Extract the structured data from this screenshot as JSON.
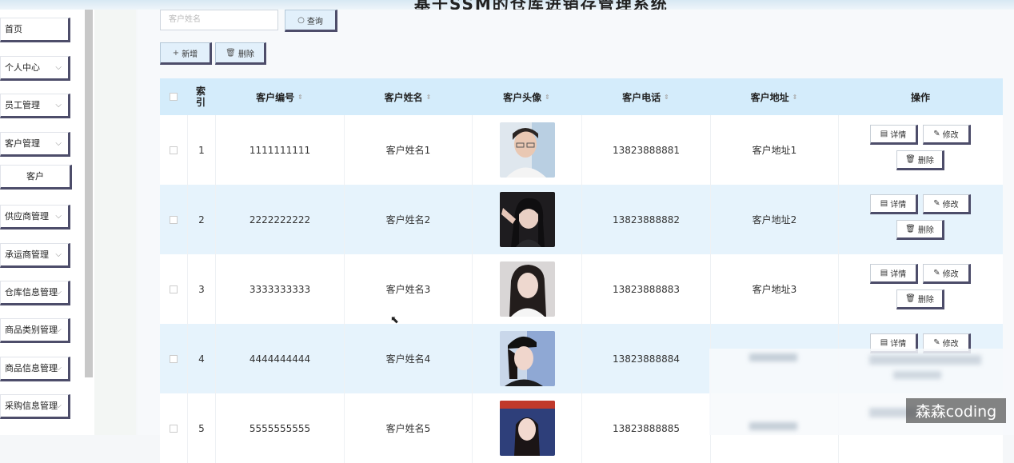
{
  "app": {
    "title": "基于SSM的仓库进销存管理系统"
  },
  "sidebar": {
    "items": [
      {
        "label": "首页",
        "chev": ""
      },
      {
        "label": "个人中心",
        "chev": "⌵"
      },
      {
        "label": "员工管理",
        "chev": "⌵"
      },
      {
        "label": "客户管理",
        "chev": "⌵"
      },
      {
        "label": "客户",
        "chev": ""
      },
      {
        "label": "供应商管理",
        "chev": "⌵"
      },
      {
        "label": "承运商管理",
        "chev": "⌵"
      },
      {
        "label": "仓库信息管理",
        "chev": "⌵"
      },
      {
        "label": "商品类别管理",
        "chev": "⌵"
      },
      {
        "label": "商品信息管理",
        "chev": "⌵"
      },
      {
        "label": "采购信息管理",
        "chev": "⌵"
      }
    ]
  },
  "search": {
    "placeholder": "客户姓名",
    "button_label": "查询"
  },
  "toolbar": {
    "add_label": "新增",
    "delete_label": "删除"
  },
  "table": {
    "columns": [
      "索引",
      "客户编号",
      "客户姓名",
      "客户头像",
      "客户电话",
      "客户地址",
      "操作"
    ],
    "rows": [
      {
        "index": "1",
        "code": "1111111111",
        "name": "客户姓名1",
        "phone": "13823888881",
        "address": "客户地址1"
      },
      {
        "index": "2",
        "code": "2222222222",
        "name": "客户姓名2",
        "phone": "13823888882",
        "address": "客户地址2"
      },
      {
        "index": "3",
        "code": "3333333333",
        "name": "客户姓名3",
        "phone": "13823888883",
        "address": "客户地址3"
      },
      {
        "index": "4",
        "code": "4444444444",
        "name": "客户姓名4",
        "phone": "13823888884",
        "address": ""
      },
      {
        "index": "5",
        "code": "5555555555",
        "name": "客户姓名5",
        "phone": "13823888885",
        "address": ""
      }
    ],
    "actions": {
      "detail": "详情",
      "edit": "修改",
      "delete": "删除"
    }
  },
  "watermark": "森森coding",
  "colors": {
    "header_bg": "#d4ecfb",
    "alt_row_bg": "#e6f3fc",
    "button_shadow": "#4d4d6a"
  }
}
